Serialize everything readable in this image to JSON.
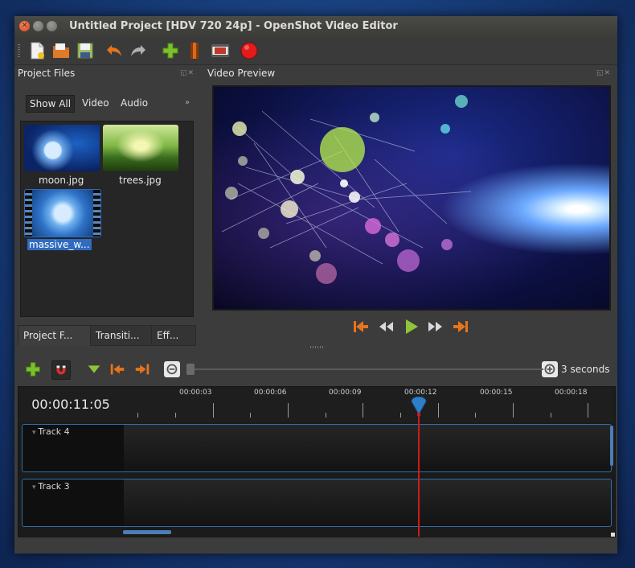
{
  "window": {
    "title": "Untitled Project [HDV 720 24p] - OpenShot Video Editor"
  },
  "toolbar": {
    "icons": [
      "new-project-icon",
      "open-project-icon",
      "save-project-icon",
      "undo-icon",
      "redo-icon",
      "import-files-icon",
      "choose-profile-icon",
      "fullscreen-icon",
      "export-video-icon"
    ]
  },
  "project_files": {
    "title": "Project Files",
    "filters": [
      "Show All",
      "Video",
      "Audio"
    ],
    "files": [
      {
        "name": "moon.jpg"
      },
      {
        "name": "trees.jpg"
      },
      {
        "name": "massive_w..."
      }
    ]
  },
  "bottom_tabs": [
    "Project F...",
    "Transiti...",
    "Eff..."
  ],
  "video_preview": {
    "title": "Video Preview"
  },
  "timeline": {
    "timecode": "00:00:11:05",
    "zoom_label": "3 seconds",
    "ruler_labels": [
      "00:00:03",
      "00:00:06",
      "00:00:09",
      "00:00:12",
      "00:00:15",
      "00:00:18"
    ],
    "tracks": [
      {
        "name": "Track 4"
      },
      {
        "name": "Track 3"
      }
    ]
  },
  "colors": {
    "accent_orange": "#e7741b",
    "play_green": "#8fc43a",
    "playhead_red": "#cc1b1b",
    "selection_blue": "#2f6bbf"
  }
}
